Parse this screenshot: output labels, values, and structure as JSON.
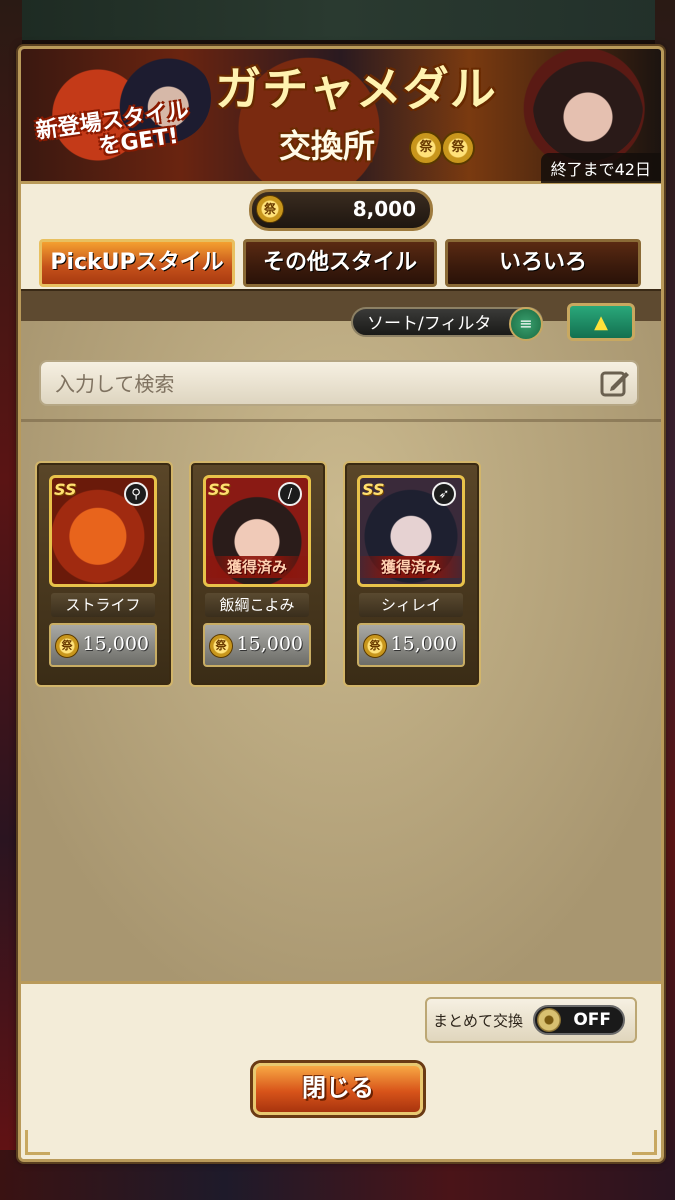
{
  "banner": {
    "title": "ガチャメダル",
    "subtitle": "交換所",
    "promo_line1": "新登場スタイル",
    "promo_line2": "をGET!",
    "countdown": "終了まで42日",
    "medal_glyph": "祭"
  },
  "currency": {
    "icon": "festival-medal-icon",
    "glyph": "祭",
    "amount": "8,000"
  },
  "tabs": [
    {
      "label": "PickUPスタイル",
      "active": true
    },
    {
      "label": "その他スタイル",
      "active": false
    },
    {
      "label": "いろいろ",
      "active": false
    }
  ],
  "toolbar": {
    "sort_label": "ソート/フィルタ",
    "collapse_glyph": "▲",
    "menu_glyph": "≡"
  },
  "search": {
    "placeholder": "入力して検索",
    "value": ""
  },
  "items": [
    {
      "name": "ストライフ",
      "price": "15,000",
      "obtained": "",
      "role_icon": "staff-icon",
      "role_glyph": "⚲",
      "rank": "SS"
    },
    {
      "name": "飯綱こよみ",
      "price": "15,000",
      "obtained": "獲得済み",
      "role_icon": "sword-icon",
      "role_glyph": "/",
      "rank": "SS"
    },
    {
      "name": "シィレイ",
      "price": "15,000",
      "obtained": "獲得済み",
      "role_icon": "bow-icon",
      "role_glyph": "➶",
      "rank": "SS"
    }
  ],
  "bulk_exchange": {
    "label": "まとめて交換",
    "state": "OFF"
  },
  "close_label": "閉じる",
  "colors": {
    "accent_orange": "#d8541a",
    "frame_gold": "#c8a860",
    "panel_bg": "#f3ecd8",
    "toggle_green": "#2aa87a"
  }
}
